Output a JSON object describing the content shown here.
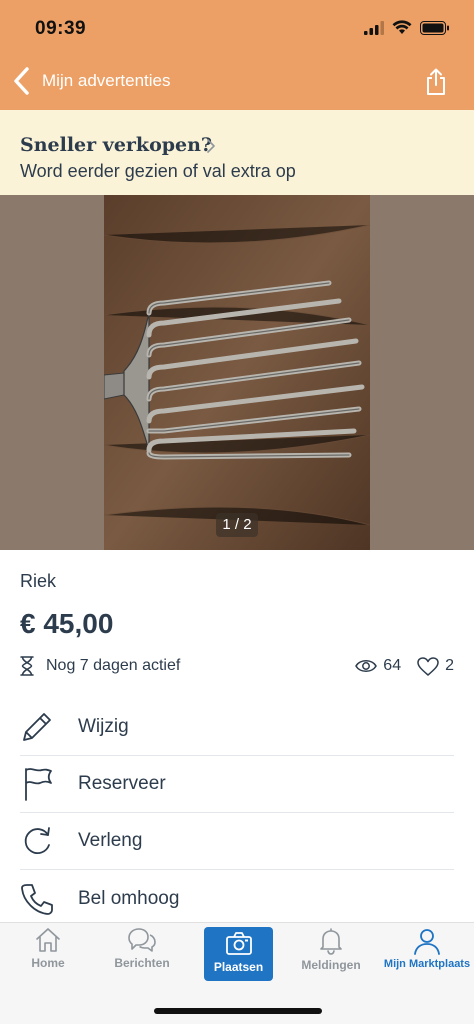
{
  "status": {
    "time": "09:39"
  },
  "nav": {
    "back_label": "Mijn advertenties"
  },
  "promo": {
    "title": "Sneller verkopen?",
    "subtitle": "Word eerder gezien of val extra op"
  },
  "gallery": {
    "counter": "1 / 2"
  },
  "listing": {
    "title": "Riek",
    "price": "€ 45,00",
    "status_text": "Nog 7 dagen actief",
    "views": "64",
    "favorites": "2"
  },
  "actions": [
    {
      "label": "Wijzig",
      "icon": "pencil-icon"
    },
    {
      "label": "Reserveer",
      "icon": "flag-icon"
    },
    {
      "label": "Verleng",
      "icon": "refresh-icon"
    },
    {
      "label": "Bel omhoog",
      "icon": "phone-icon"
    }
  ],
  "tabs": [
    {
      "label": "Home",
      "icon": "home-icon"
    },
    {
      "label": "Berichten",
      "icon": "chat-icon"
    },
    {
      "label": "Plaatsen",
      "icon": "camera-icon"
    },
    {
      "label": "Meldingen",
      "icon": "bell-icon"
    },
    {
      "label": "Mijn Marktplaats",
      "icon": "user-icon"
    }
  ],
  "colors": {
    "header": "#eda065",
    "promo": "#fbf3d8",
    "accent": "#1f74c4",
    "text": "#2d3c4d"
  }
}
